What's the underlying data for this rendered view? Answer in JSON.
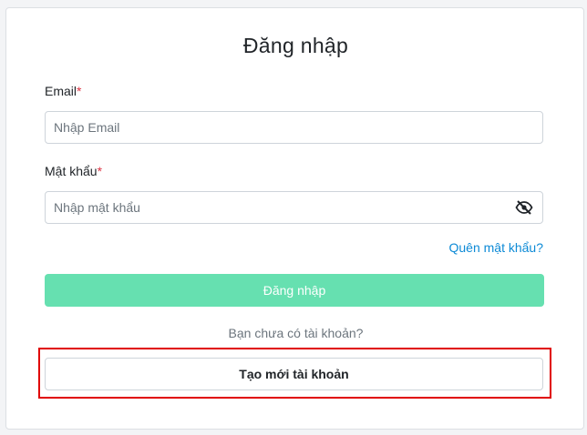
{
  "login_form": {
    "title": "Đăng nhập",
    "email": {
      "label": "Email",
      "required_mark": "*",
      "placeholder": "Nhập Email",
      "value": ""
    },
    "password": {
      "label": "Mật khẩu",
      "required_mark": "*",
      "placeholder": "Nhập mật khẩu",
      "value": "",
      "toggle_icon": "eye-slash-icon"
    },
    "forgot_password_link": "Quên mật khẩu?",
    "submit_button": "Đăng nhập",
    "no_account_text": "Bạn chưa có tài khoản?",
    "create_account_button": "Tạo mới tài khoản"
  },
  "colors": {
    "primary_button": "#66e0b0",
    "link": "#0d8ad6",
    "required": "#dc3545",
    "highlight_border": "#e00000"
  }
}
